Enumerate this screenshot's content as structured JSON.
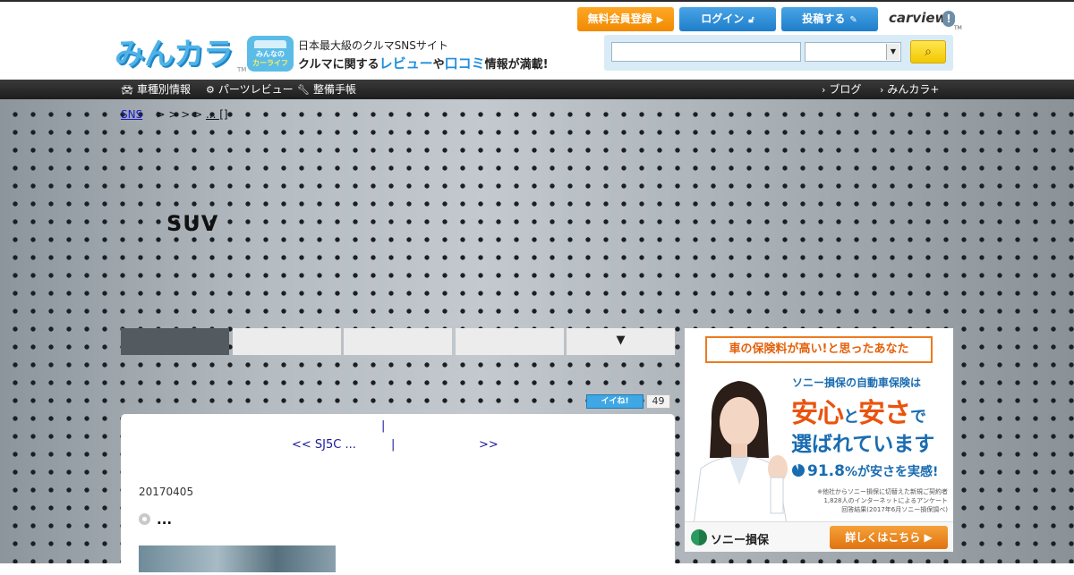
{
  "header": {
    "logo_text": "みんカラ",
    "logo_tm": "TM",
    "logo_badge_line1": "みんなの",
    "logo_badge_line2": "カーライフ",
    "tagline_top": "日本最大級のクルマSNSサイト",
    "tagline_a": "クルマに関する",
    "tagline_review": "レビュー",
    "tagline_ya": "や",
    "tagline_kuchikomi": "口コミ",
    "tagline_b": "情報が満載!",
    "register_label": "無料会員登録",
    "login_label": "ログイン",
    "post_label": "投稿する",
    "carview_label": "carview",
    "carview_tm": "TM",
    "search": {
      "input_value": "",
      "select_value": ""
    }
  },
  "nav": {
    "left": [
      "車種別情報",
      "パーツレビュー",
      "整備手帳"
    ],
    "right": [
      "ブログ",
      "みんカラ+"
    ]
  },
  "breadcrumb": {
    "root": "SNS",
    "separators": "> > > >",
    "tail": "... []"
  },
  "blog": {
    "title": "SUV"
  },
  "tabs": {
    "more": "▼"
  },
  "iine": {
    "label": "イイね!",
    "count": "49"
  },
  "pager": {
    "sep_top": "|",
    "prev": "<< SJ5C ...",
    "sep": "|",
    "next": ">>"
  },
  "post": {
    "date": "20170405",
    "title": "..."
  },
  "ad": {
    "headline": "車の保険料が高い!と思ったあなた",
    "sub": "ソニー損保の自動車保険は",
    "big1_a": "安心",
    "big1_to": "と",
    "big1_b": "安さ",
    "big1_de": "で",
    "big2": "選ばれています",
    "stat_value": "91.8",
    "stat_rest": "%が安さを実感!",
    "note_line1": "※他社からソニー損保に切替えた新規ご契約者",
    "note_line2": "1,828人のインターネットによるアンケート",
    "note_line3": "回答結果(2017年6月ソニー損保調べ)",
    "brand": "ソニー損保",
    "cta": "詳しくはこちら"
  },
  "colors": {
    "accent_blue": "#1f7ecb",
    "accent_orange": "#f08a00",
    "link": "#1a1a99"
  }
}
